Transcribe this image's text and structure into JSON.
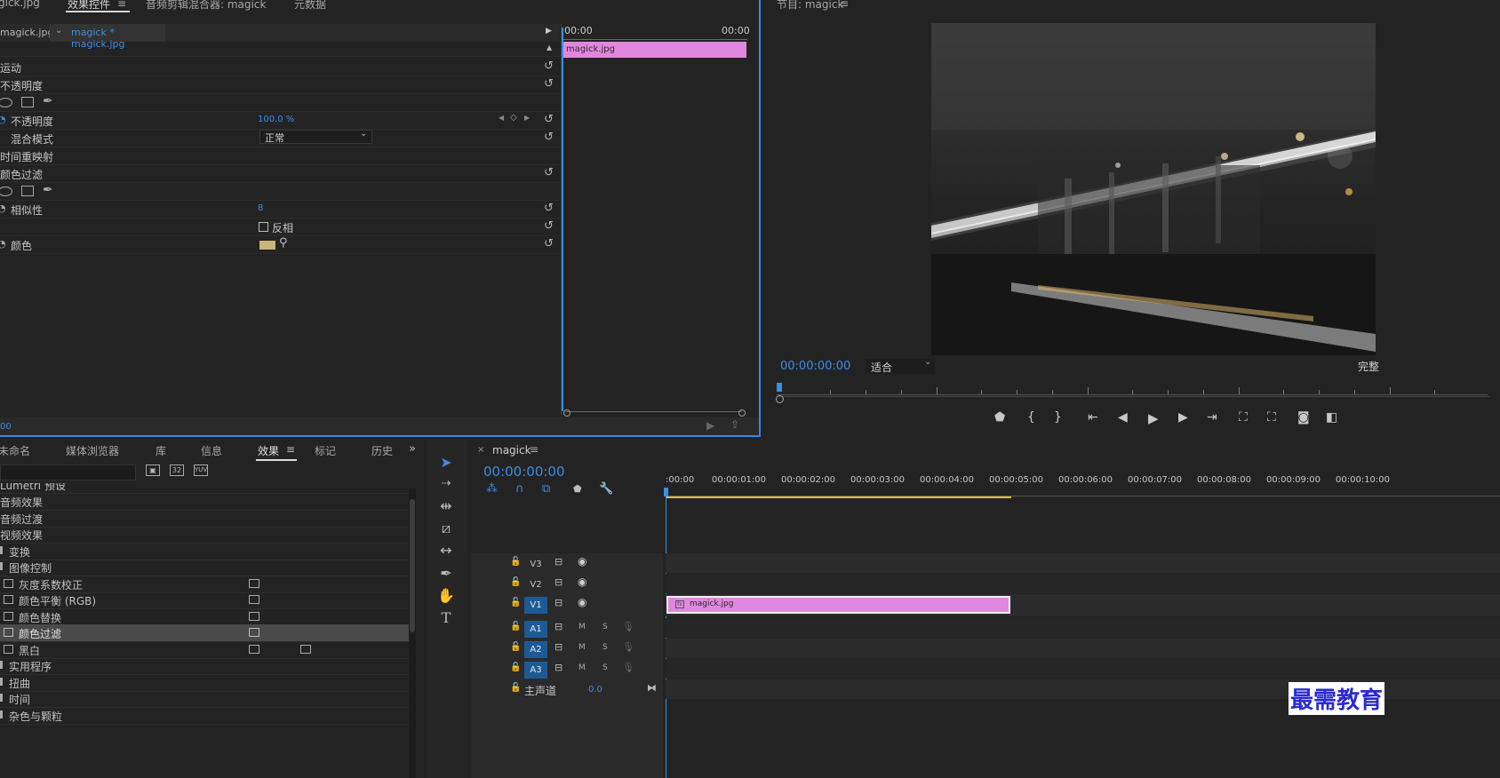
{
  "effect_controls": {
    "top_tabs": [
      "gick.jpg",
      "效果控件",
      "音频剪辑混合器: magick",
      "元数据"
    ],
    "source_clip": "magick.jpg",
    "target_clip": "magick * magick.jpg",
    "timeline_start": "00:00",
    "timeline_end": "00:00",
    "clip_label": "magick.jpg",
    "footer_time": "00",
    "rows": {
      "motion": "运动",
      "opacity_group": "不透明度",
      "opacity_label": "不透明度",
      "opacity_value": "100.0 %",
      "blend_mode_label": "混合模式",
      "blend_mode_value": "正常",
      "time_remap": "时间重映射",
      "color_pass": "颜色过滤",
      "similarity_label": "相似性",
      "similarity_value": "8",
      "invert_label": "反相",
      "color_label": "颜色"
    },
    "color_swatch": "#c9b57a"
  },
  "program_monitor": {
    "tab_title": "节目: magick",
    "timecode": "00:00:00:00",
    "fit_select": "适合",
    "quality": "完整"
  },
  "project_panel": {
    "tabs": [
      "未命名",
      "媒体浏览器",
      "库",
      "信息",
      "效果",
      "标记",
      "历史"
    ],
    "active_tab": "效果",
    "effects_list": [
      {
        "label": "Lumetri 预设",
        "level": 0,
        "badge": false
      },
      {
        "label": "音频效果",
        "level": 0,
        "badge": false
      },
      {
        "label": "音频过渡",
        "level": 0,
        "badge": false
      },
      {
        "label": "视频效果",
        "level": 0,
        "badge": false
      },
      {
        "label": "变换",
        "level": 1,
        "badge": false
      },
      {
        "label": "图像控制",
        "level": 1,
        "badge": false
      },
      {
        "label": "灰度系数校正",
        "level": 2,
        "badge": true
      },
      {
        "label": "颜色平衡 (RGB)",
        "level": 2,
        "badge": true
      },
      {
        "label": "颜色替换",
        "level": 2,
        "badge": true
      },
      {
        "label": "颜色过滤",
        "level": 2,
        "badge": true,
        "selected": true
      },
      {
        "label": "黑白",
        "level": 2,
        "badge": true,
        "badge2": true
      },
      {
        "label": "实用程序",
        "level": 1,
        "badge": false
      },
      {
        "label": "扭曲",
        "level": 1,
        "badge": false
      },
      {
        "label": "时间",
        "level": 1,
        "badge": false
      },
      {
        "label": "杂色与颗粒",
        "level": 1,
        "badge": false
      }
    ]
  },
  "tools": [
    "selection",
    "track-select",
    "ripple-edit",
    "razor",
    "slip",
    "pen",
    "hand",
    "type"
  ],
  "sequence": {
    "name": "magick",
    "timecode": "00:00:00:00",
    "ruler": [
      ":00:00",
      "00:00:01:00",
      "00:00:02:00",
      "00:00:03:00",
      "00:00:04:00",
      "00:00:05:00",
      "00:00:06:00",
      "00:00:07:00",
      "00:00:08:00",
      "00:00:09:00",
      "00:00:10:00"
    ],
    "video_tracks": [
      "V3",
      "V2",
      "V1"
    ],
    "audio_tracks": [
      "A1",
      "A2",
      "A3"
    ],
    "master_label": "主声道",
    "master_value": "0.0",
    "clip_name": "magick.jpg",
    "clip_color": "#e287e0",
    "mute": "M",
    "solo": "S"
  },
  "watermark": "最需教育"
}
